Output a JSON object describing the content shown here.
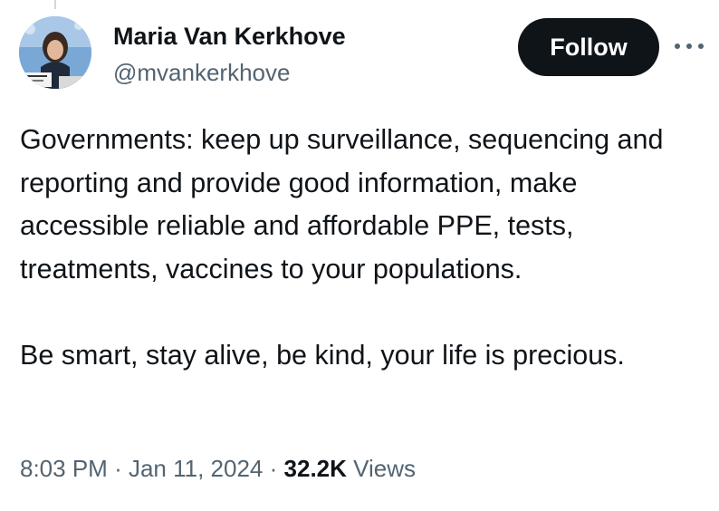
{
  "tweet": {
    "author": {
      "name": "Maria Van Kerkhove",
      "handle": "@mvankerkhove",
      "avatar_icon": "profile-photo"
    },
    "follow_label": "Follow",
    "more_icon": "ellipsis-icon",
    "paragraphs": [
      "Governments: keep up surveillance, sequencing and reporting and provide good information, make accessible reliable and affordable PPE, tests, treatments, vaccines to your populations.",
      "Be smart, stay alive, be kind, your life is precious."
    ],
    "time": "8:03 PM",
    "separator": "·",
    "date": "Jan 11, 2024",
    "views_count": "32.2K",
    "views_label": "Views"
  },
  "colors": {
    "text": "#0f1419",
    "secondary": "#536471",
    "button_bg": "#0f1419",
    "button_text": "#ffffff"
  }
}
